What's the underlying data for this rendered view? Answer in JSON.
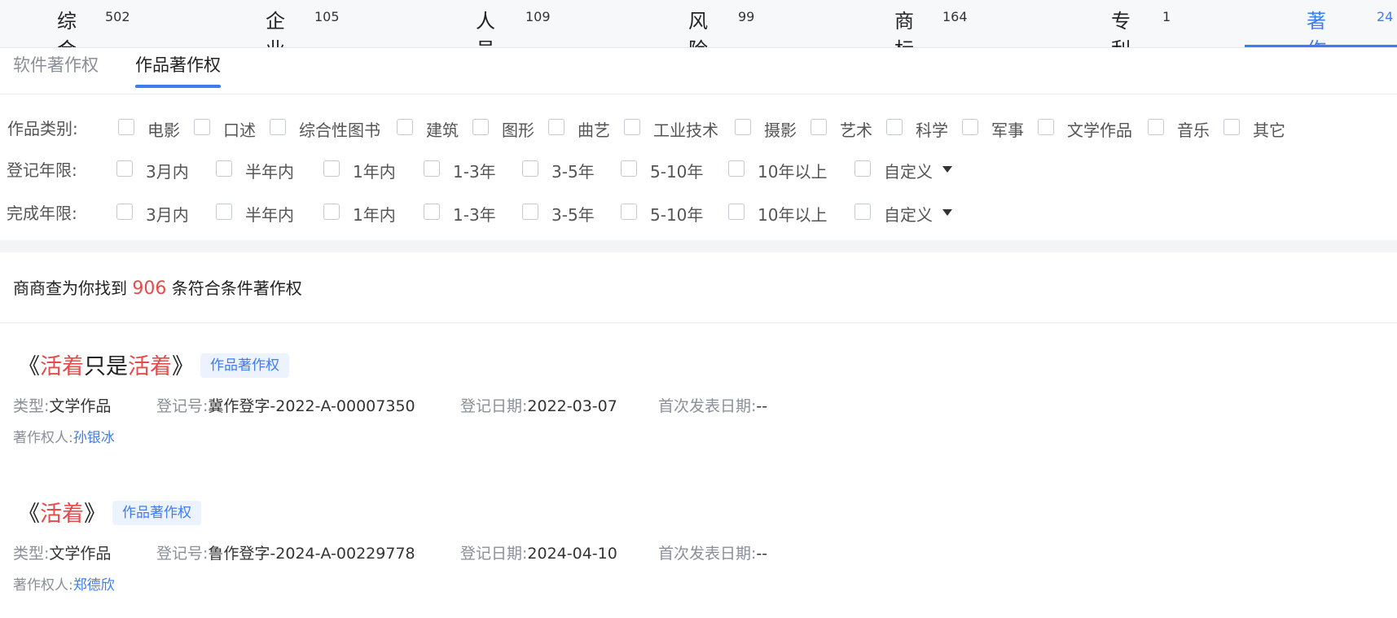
{
  "topnav": [
    {
      "label": "综合",
      "count": "502"
    },
    {
      "label": "企业",
      "count": "105"
    },
    {
      "label": "人员",
      "count": "109"
    },
    {
      "label": "风险",
      "count": "99"
    },
    {
      "label": "商标",
      "count": "164"
    },
    {
      "label": "专利",
      "count": "1"
    },
    {
      "label": "著作权",
      "count": "24"
    }
  ],
  "subtabs": [
    {
      "label": "软件著作权"
    },
    {
      "label": "作品著作权"
    }
  ],
  "filters": {
    "category": {
      "label": "作品类别:",
      "options": [
        "电影",
        "口述",
        "综合性图书",
        "建筑",
        "图形",
        "曲艺",
        "工业技术",
        "摄影",
        "艺术",
        "科学",
        "军事",
        "文学作品",
        "音乐",
        "其它"
      ]
    },
    "register": {
      "label": "登记年限:",
      "options": [
        "3月内",
        "半年内",
        "1年内",
        "1-3年",
        "3-5年",
        "5-10年",
        "10年以上",
        "自定义"
      ]
    },
    "complete": {
      "label": "完成年限:",
      "options": [
        "3月内",
        "半年内",
        "1年内",
        "1-3年",
        "3-5年",
        "5-10年",
        "10年以上",
        "自定义"
      ]
    }
  },
  "summary": {
    "prefix": "商商查为你找到",
    "count": "906",
    "suffix": "条符合条件著作权"
  },
  "results": [
    {
      "title_parts": [
        "《",
        "活着",
        "只是",
        "活着",
        "》"
      ],
      "tag": "作品著作权",
      "type_label": "类型:",
      "type_value": "文学作品",
      "regno_label": "登记号:",
      "regno_value": "冀作登字-2022-A-00007350",
      "regdate_label": "登记日期:",
      "regdate_value": "2022-03-07",
      "pubdate_label": "首次发表日期:",
      "pubdate_value": "--",
      "owner_label": "著作权人:",
      "owner_value": "孙银冰"
    },
    {
      "title_parts": [
        "《",
        "活着",
        "》"
      ],
      "tag": "作品著作权",
      "type_label": "类型:",
      "type_value": "文学作品",
      "regno_label": "登记号:",
      "regno_value": "鲁作登字-2024-A-00229778",
      "regdate_label": "登记日期:",
      "regdate_value": "2024-04-10",
      "pubdate_label": "首次发表日期:",
      "pubdate_value": "--",
      "owner_label": "著作权人:",
      "owner_value": "郑德欣"
    }
  ],
  "colors": {
    "accent": "#3f7cf0",
    "highlight": "#e84a4a"
  }
}
